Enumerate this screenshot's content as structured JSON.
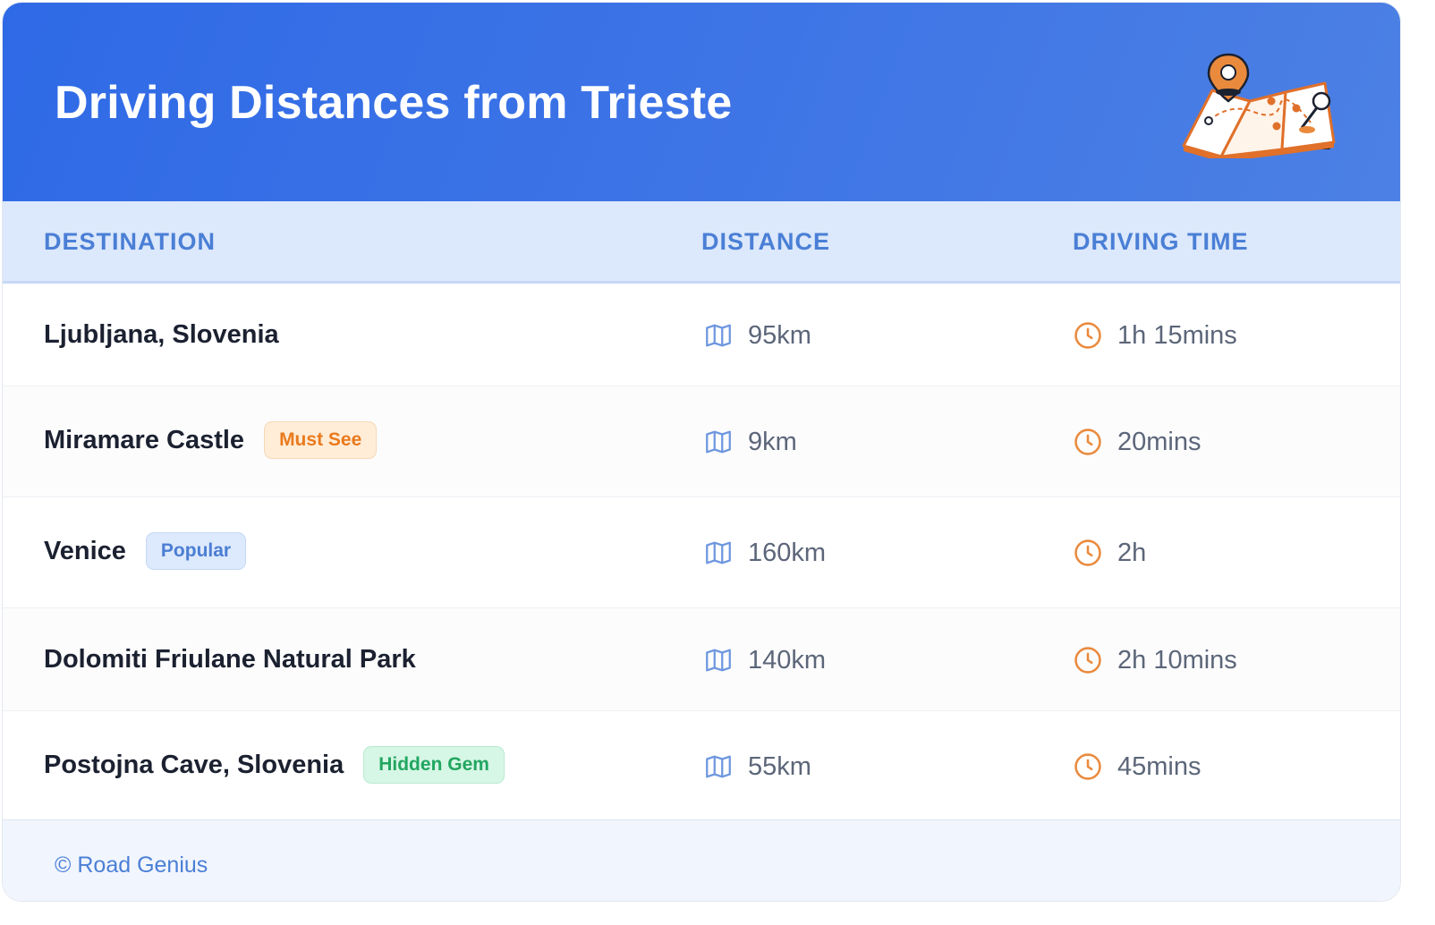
{
  "header": {
    "title": "Driving Distances from Trieste",
    "illustration_icon": "map-with-pin-icon"
  },
  "columns": {
    "destination": "DESTINATION",
    "distance": "DISTANCE",
    "driving_time": "DRIVING TIME"
  },
  "rows": [
    {
      "destination": "Ljubljana, Slovenia",
      "badge": "",
      "distance": "95km",
      "time": "1h 15mins"
    },
    {
      "destination": "Miramare Castle",
      "badge": "Must See",
      "badge_color": "#ea7a1d",
      "distance": "9km",
      "time": "20mins"
    },
    {
      "destination": "Venice",
      "badge": "Popular",
      "badge_color": "#4b7ed3",
      "distance": "160km",
      "time": "2h"
    },
    {
      "destination": "Dolomiti Friulane Natural Park",
      "badge": "",
      "distance": "140km",
      "time": "2h 10mins"
    },
    {
      "destination": "Postojna Cave, Slovenia",
      "badge": "Hidden Gem",
      "badge_color": "#22a660",
      "distance": "55km",
      "time": "45mins"
    }
  ],
  "icons": {
    "distance": "map-icon",
    "time": "clock-icon"
  },
  "footer": {
    "text": "© Road Genius"
  },
  "colors": {
    "header_blue": "#2f6ae6",
    "accent_blue": "#4a7fd6",
    "accent_orange": "#ea8a3d"
  }
}
